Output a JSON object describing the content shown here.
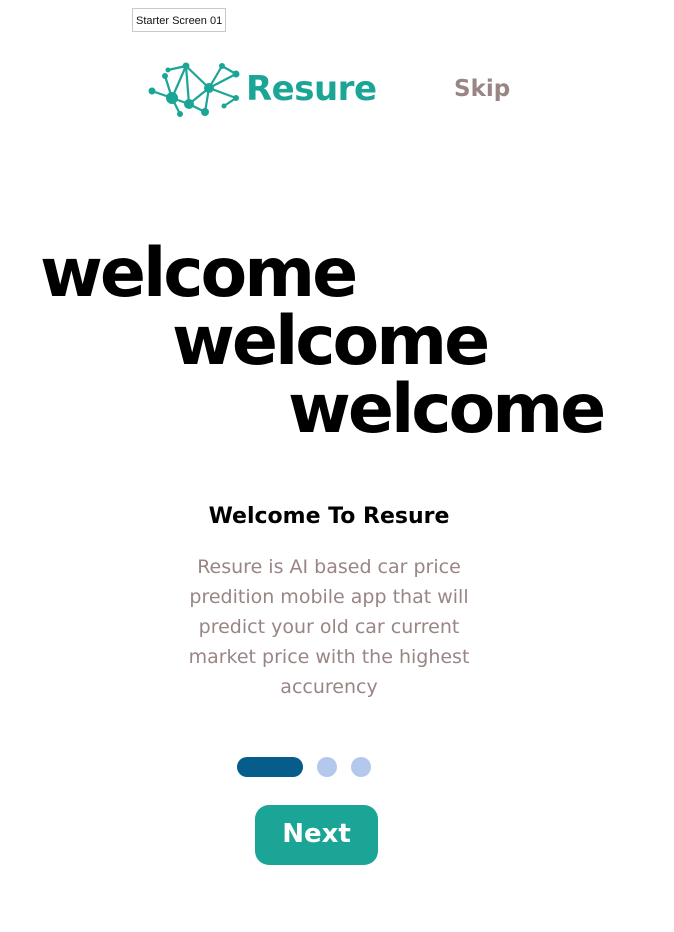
{
  "frame": {
    "label": "Starter Screen 01"
  },
  "header": {
    "logo_text": "Resure",
    "logo_icon": "network-nodes-icon",
    "skip_label": "Skip"
  },
  "hero": {
    "welcome_lines": [
      "welcome",
      "welcome",
      "welcome"
    ]
  },
  "content": {
    "heading": "Welcome To Resure",
    "description": "Resure is AI based car price predition mobile app that will predict your old car current market price with the highest accurency"
  },
  "pager": {
    "total_pages": 3,
    "current_page": 1
  },
  "actions": {
    "next_label": "Next"
  },
  "colors": {
    "brand": "#1aa597",
    "muted_text": "#9a8585",
    "pager_active": "#065c8b",
    "pager_inactive": "#b3c8ec"
  }
}
